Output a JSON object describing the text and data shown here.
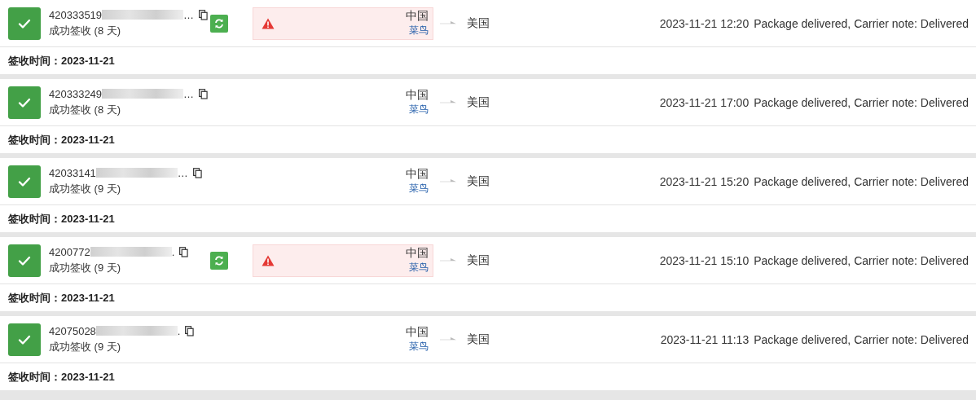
{
  "shipments": [
    {
      "tracking": "420333519",
      "tail": "…",
      "status": "成功签收 (8 天)",
      "sync": true,
      "alert": true,
      "origin": "中国",
      "carrier": "菜鸟",
      "destination": "美国",
      "time": "2023-11-21 12:20",
      "event": "Package delivered, Carrier note: Delivered",
      "footer": "签收时间：2023-11-21"
    },
    {
      "tracking": "420333249",
      "tail": "…",
      "status": "成功签收 (8 天)",
      "sync": false,
      "alert": false,
      "origin": "中国",
      "carrier": "菜鸟",
      "destination": "美国",
      "time": "2023-11-21 17:00",
      "event": "Package delivered, Carrier note: Delivered",
      "footer": "签收时间：2023-11-21"
    },
    {
      "tracking": "42033141",
      "tail": "…",
      "status": "成功签收 (9 天)",
      "sync": false,
      "alert": false,
      "origin": "中国",
      "carrier": "菜鸟",
      "destination": "美国",
      "time": "2023-11-21 15:20",
      "event": "Package delivered, Carrier note: Delivered",
      "footer": "签收时间：2023-11-21"
    },
    {
      "tracking": "4200772",
      "tail": ".",
      "status": "成功签收 (9 天)",
      "sync": true,
      "alert": true,
      "origin": "中国",
      "carrier": "菜鸟",
      "destination": "美国",
      "time": "2023-11-21 15:10",
      "event": "Package delivered, Carrier note: Delivered",
      "footer": "签收时间：2023-11-21"
    },
    {
      "tracking": "42075028",
      "tail": ".",
      "status": "成功签收 (9 天)",
      "sync": false,
      "alert": false,
      "origin": "中国",
      "carrier": "菜鸟",
      "destination": "美国",
      "time": "2023-11-21 11:13",
      "event": "Package delivered, Carrier note: Delivered",
      "footer": "签收时间：2023-11-21"
    }
  ]
}
